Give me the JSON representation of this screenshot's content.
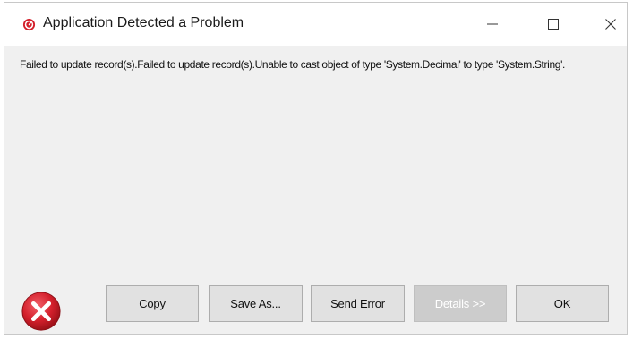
{
  "window": {
    "title": "Application Detected a Problem",
    "controls": {
      "minimize_icon": "minimize-icon",
      "maximize_icon": "maximize-icon",
      "close_icon": "close-icon"
    }
  },
  "message": {
    "text": "Failed to update record(s).Failed to update record(s).Unable to cast object of type 'System.Decimal' to type 'System.String'."
  },
  "buttons": {
    "copy": "Copy",
    "save_as": "Save As...",
    "send_error": "Send Error",
    "details": "Details >>",
    "ok": "OK"
  },
  "button_states": {
    "details_enabled": false
  },
  "icons": {
    "app": "app-error-icon",
    "dialog": "error-icon"
  },
  "colors": {
    "error_red": "#d4202c",
    "dialog_background": "#f0f0f0",
    "titlebar_background": "#ffffff",
    "button_background": "#e1e1e1",
    "button_disabled_background": "#cccccc"
  }
}
